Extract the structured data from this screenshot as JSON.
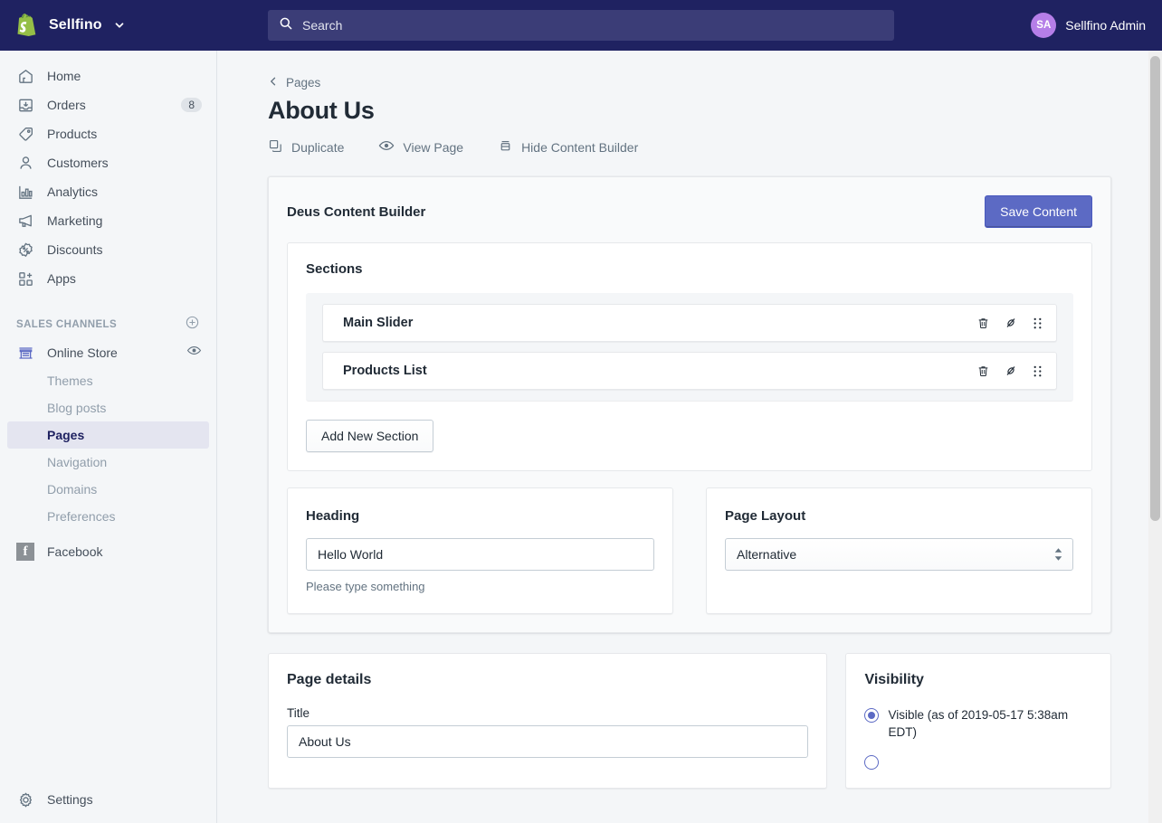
{
  "topbar": {
    "brand_name": "Sellfino",
    "brand_caret_icon": "chevron-down-icon",
    "logo_icon": "shopify-bag-icon",
    "search": {
      "icon": "search-icon",
      "placeholder": "Search",
      "value": ""
    },
    "user": {
      "initials": "SA",
      "name": "Sellfino Admin"
    }
  },
  "sidebar": {
    "items": [
      {
        "label": "Home",
        "icon": "home-icon",
        "badge": ""
      },
      {
        "label": "Orders",
        "icon": "orders-inbox-icon",
        "badge": "8"
      },
      {
        "label": "Products",
        "icon": "products-tag-icon",
        "badge": ""
      },
      {
        "label": "Customers",
        "icon": "customers-person-icon",
        "badge": ""
      },
      {
        "label": "Analytics",
        "icon": "analytics-bars-icon",
        "badge": ""
      },
      {
        "label": "Marketing",
        "icon": "marketing-megaphone-icon",
        "badge": ""
      },
      {
        "label": "Discounts",
        "icon": "discounts-percent-icon",
        "badge": ""
      },
      {
        "label": "Apps",
        "icon": "apps-grid-plus-icon",
        "badge": ""
      }
    ],
    "sales_channels": {
      "label": "SALES CHANNELS",
      "add_icon": "plus-circle-icon",
      "online_store": {
        "label": "Online Store",
        "icon": "storefront-icon",
        "view_icon": "eye-icon"
      },
      "sub_items": [
        {
          "label": "Themes",
          "active": false
        },
        {
          "label": "Blog posts",
          "active": false
        },
        {
          "label": "Pages",
          "active": true
        },
        {
          "label": "Navigation",
          "active": false
        },
        {
          "label": "Domains",
          "active": false
        },
        {
          "label": "Preferences",
          "active": false
        }
      ],
      "facebook": {
        "label": "Facebook",
        "icon": "facebook-icon"
      }
    },
    "settings": {
      "label": "Settings",
      "icon": "gear-icon"
    }
  },
  "page": {
    "breadcrumb": {
      "label": "Pages",
      "icon": "chevron-left-icon"
    },
    "title": "About Us",
    "actions": [
      {
        "label": "Duplicate",
        "icon": "duplicate-icon"
      },
      {
        "label": "View Page",
        "icon": "eye-icon"
      },
      {
        "label": "Hide Content Builder",
        "icon": "hide-builder-icon"
      }
    ]
  },
  "builder": {
    "title": "Deus Content Builder",
    "save_label": "Save Content",
    "sections_title": "Sections",
    "sections": [
      {
        "name": "Main Slider",
        "delete_icon": "trash-icon",
        "hide_icon": "eye-slash-icon",
        "drag_icon": "drag-handle-icon"
      },
      {
        "name": "Products List",
        "delete_icon": "trash-icon",
        "hide_icon": "eye-slash-icon",
        "drag_icon": "drag-handle-icon"
      }
    ],
    "add_section_label": "Add New Section",
    "heading_field": {
      "label": "Heading",
      "value": "Hello World",
      "placeholder": "",
      "help_text": "Please type something"
    },
    "page_layout_field": {
      "label": "Page Layout",
      "value": "Alternative",
      "arrows_icon": "select-arrows-icon"
    }
  },
  "page_details": {
    "heading": "Page details",
    "title_label": "Title",
    "title_value": "About Us",
    "title_placeholder": ""
  },
  "visibility": {
    "heading": "Visibility",
    "options": [
      {
        "label": "Visible (as of 2019-05-17 5:38am EDT)",
        "checked": true
      },
      {
        "label": "",
        "checked": false
      }
    ]
  },
  "colors": {
    "topbar": "#1f2261",
    "accent": "#5c6ac4",
    "avatar": "#b57ee8",
    "sidebar_bg": "#f4f6f8",
    "active_item_bg": "#e4e5f0"
  }
}
